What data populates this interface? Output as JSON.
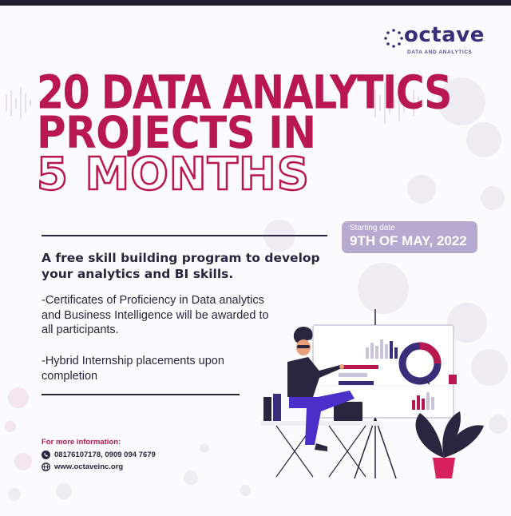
{
  "brand": {
    "name": "octave",
    "tagline": "DATA AND ANALYTICS",
    "colors": {
      "primary": "#3a2d7a",
      "accent": "#b8174f",
      "badge": "#b7a9cf"
    }
  },
  "headline": {
    "line1": "20 DATA ANALYTICS",
    "line2": "PROJECTS IN",
    "line3": "5 MONTHS"
  },
  "start": {
    "label": "Starting date",
    "date": "9TH OF MAY, 2022"
  },
  "lead": "A free skill building program to develop your analytics and BI skills.",
  "benefits": [
    "-Certificates of Proficiency in Data analytics and Business Intelligence will be awarded to all participants.",
    "-Hybrid Internship placements upon completion"
  ],
  "contact": {
    "title": "For more information:",
    "phone": "08176107178, 0909 094 7679",
    "website": "www.octaveinc.org",
    "icons": [
      "phone-icon",
      "globe-icon"
    ]
  }
}
